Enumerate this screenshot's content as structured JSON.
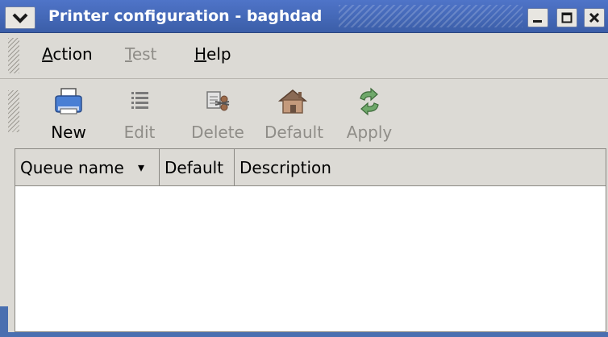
{
  "window": {
    "title": "Printer configuration - baghdad"
  },
  "menubar": {
    "items": [
      {
        "label_access": "A",
        "label_rest": "ction",
        "enabled": true
      },
      {
        "label_access": "T",
        "label_rest": "est",
        "enabled": false
      },
      {
        "label_access": "H",
        "label_rest": "elp",
        "enabled": true
      }
    ]
  },
  "toolbar": {
    "new_label": "New",
    "edit_label": "Edit",
    "delete_label": "Delete",
    "default_label": "Default",
    "apply_label": "Apply"
  },
  "queue_list": {
    "columns": [
      "Queue name",
      "Default",
      "Description"
    ],
    "sort_indicator": "▾",
    "rows": []
  },
  "icons": {
    "window_menu": "chevron-down-icon",
    "minimize": "minimize-icon",
    "maximize": "maximize-icon",
    "close": "close-icon",
    "new": "printer-icon",
    "edit": "list-icon",
    "delete": "scissors-icon",
    "default": "home-icon",
    "apply": "refresh-icon"
  },
  "colors": {
    "titlebar": "#4f74c8",
    "window_bg": "#dcdad5",
    "disabled_text": "#8f8d88",
    "list_bg": "#ffffff"
  }
}
